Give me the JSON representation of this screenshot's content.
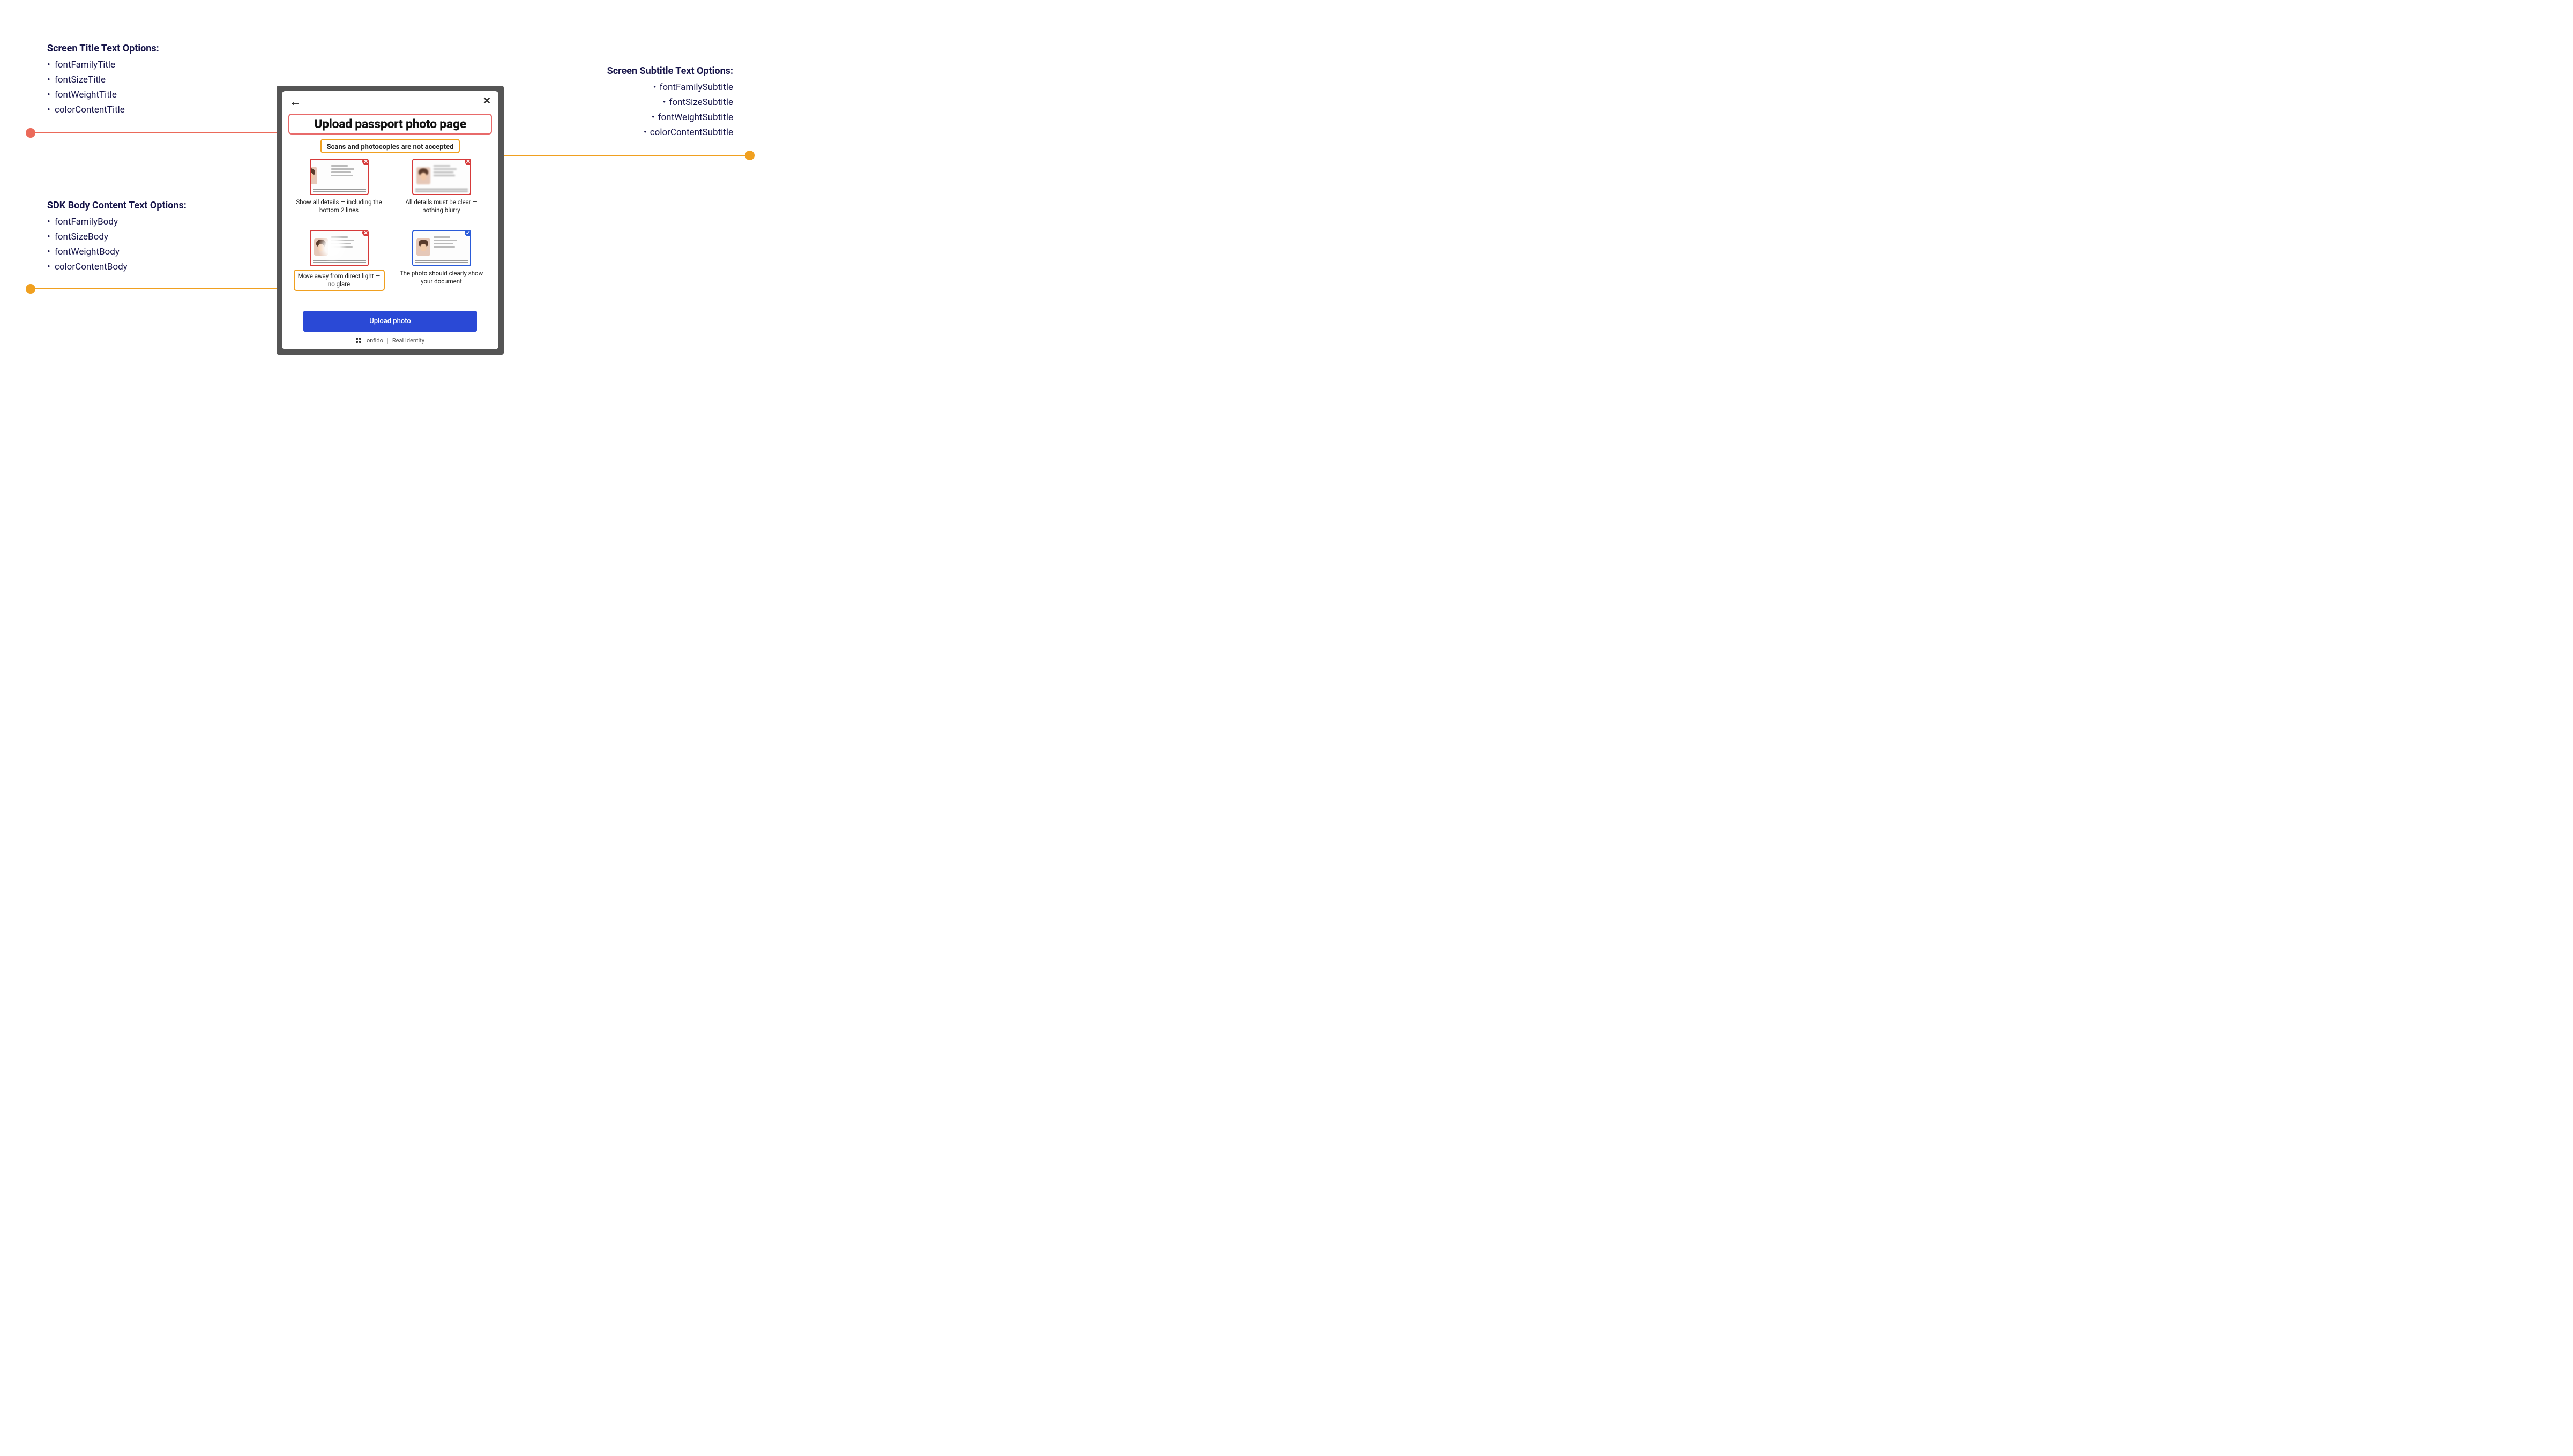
{
  "callouts": {
    "title": {
      "heading": "Screen Title Text Options:",
      "items": [
        "fontFamilyTitle",
        "fontSizeTitle",
        "fontWeightTitle",
        "colorContentTitle"
      ]
    },
    "subtitle": {
      "heading": "Screen Subtitle Text Options:",
      "items": [
        "fontFamilySubtitle",
        "fontSizeSubtitle",
        "fontWeightSubtitle",
        "colorContentSubtitle"
      ]
    },
    "body": {
      "heading": "SDK Body Content Text Options:",
      "items": [
        "fontFamilyBody",
        "fontSizeBody",
        "fontWeightBody",
        "colorContentBody"
      ]
    }
  },
  "screen": {
    "back_icon": "←",
    "close_icon": "✕",
    "title": "Upload passport photo page",
    "subtitle": "Scans and photocopies are not accepted",
    "examples": {
      "cut": {
        "caption": "Show all details — including the bottom 2 lines"
      },
      "blur": {
        "caption": "All details must be clear — nothing blurry"
      },
      "glare": {
        "caption": "Move away from direct light — no glare"
      },
      "good": {
        "caption": "The photo should clearly show your document"
      }
    },
    "upload_button": "Upload photo",
    "footer_brand": "onfido",
    "footer_tag": "Real Identity"
  },
  "colors": {
    "annotation_red": "#eb6a5a",
    "annotation_amber": "#f0a020",
    "primary_button": "#2a49d6",
    "text_navy": "#18164a"
  }
}
